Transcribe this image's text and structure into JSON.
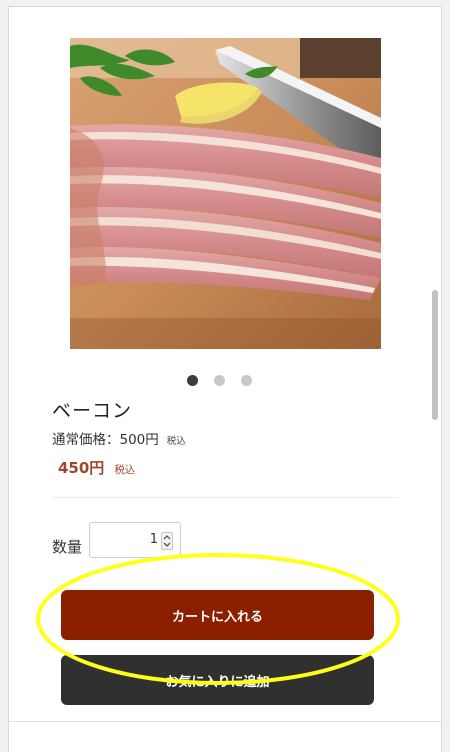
{
  "product": {
    "title": "ベーコン",
    "regular_price_text": "通常価格：500円",
    "regular_price_tax": "税込",
    "sale_price": "450円",
    "sale_price_tax": "税込"
  },
  "carousel": {
    "dot_count": 3,
    "active_index": 0
  },
  "quantity": {
    "label": "数量",
    "value": "1"
  },
  "buttons": {
    "add_to_cart": "カートに入れる",
    "add_to_favorites": "お気に入りに追加"
  },
  "colors": {
    "cart_button": "#8c1f00",
    "favorites_button": "#303030",
    "sale_price": "#a0462b",
    "highlight": "#ffff1a"
  },
  "icons": {
    "product_image": "bacon-photo",
    "stepper": "up-down-chevron-icon"
  }
}
